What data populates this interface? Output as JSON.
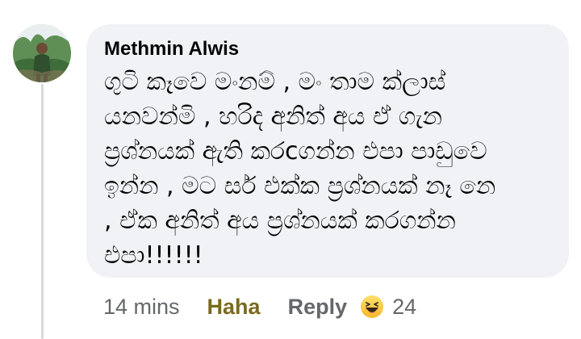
{
  "comment": {
    "author": "Methmin Alwis",
    "avatar_icon": "profile-photo",
    "text": "ගුටි කෑවෙ මංනම් , මං තාම ක්ලාස් \nයනවන්මි , හරිද අනිත් අය ඒ ගැන \nප්‍රශ්නයක් ඇති කරcගන්න එපා පාඩුවෙ \nඉන්න , මට සර් එක්ක ප්‍රශ්නයක් නෑ නෙ \n, ඒක අනිත් අය ප්‍රශ්නයක් කරගන්න \nඑපා!!!!!!"
  },
  "actions": {
    "timestamp": "14 mins",
    "reaction_label": "Haha",
    "reply_label": "Reply",
    "reaction_icon": "haha-emoji-icon",
    "reaction_count": "24"
  },
  "colors": {
    "bubble_bg": "#f0f2f5",
    "reaction_label": "#7a6a1e",
    "muted_text": "#65676b",
    "thread_line": "#d7d9dd"
  }
}
